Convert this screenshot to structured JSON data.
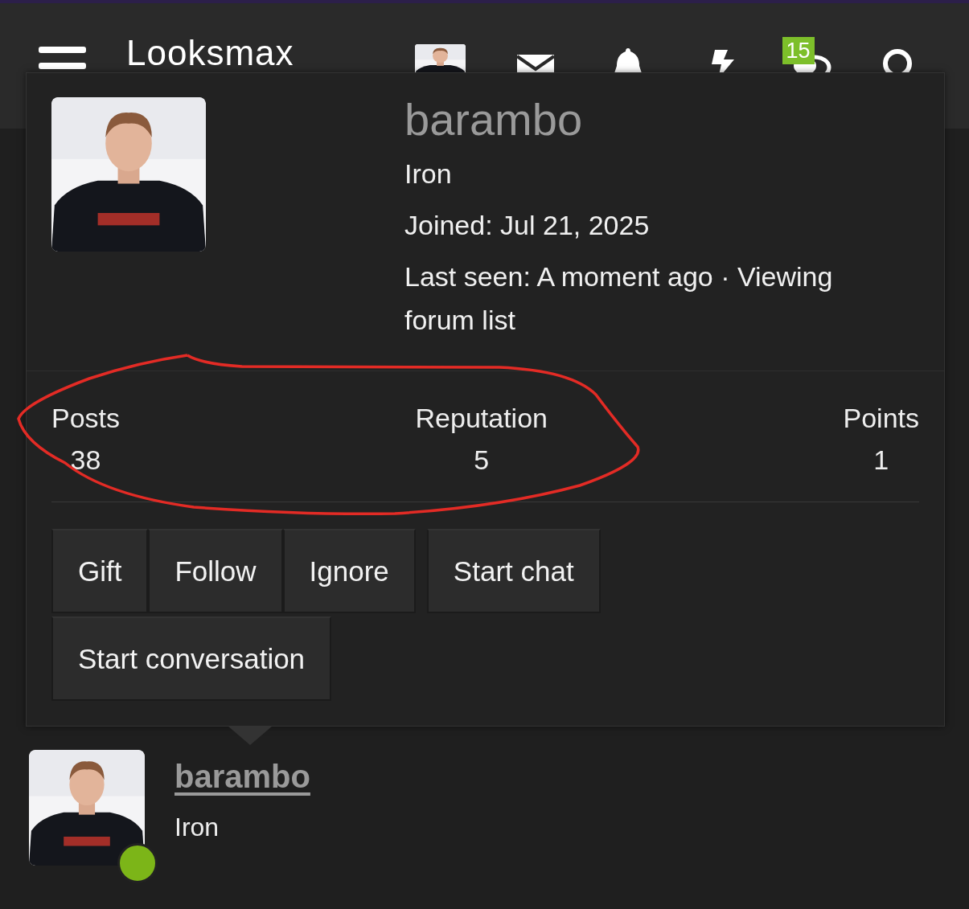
{
  "header": {
    "logo": "Looksmax",
    "alerts_badge": "15"
  },
  "popup": {
    "name": "barambo",
    "title": "Iron",
    "joined": "Joined: Jul 21, 2025",
    "last_seen": "Last seen: A moment ago · Viewing forum list",
    "stats": [
      {
        "label": "Posts",
        "value": "38"
      },
      {
        "label": "Reputation",
        "value": "5"
      },
      {
        "label": "Points",
        "value": "1"
      }
    ],
    "button_groups": [
      [
        "Gift",
        "Follow",
        "Ignore"
      ],
      [
        "Start chat"
      ],
      [
        "Start conversation"
      ]
    ]
  },
  "member": {
    "name": "barambo",
    "title": "Iron",
    "online": true
  }
}
